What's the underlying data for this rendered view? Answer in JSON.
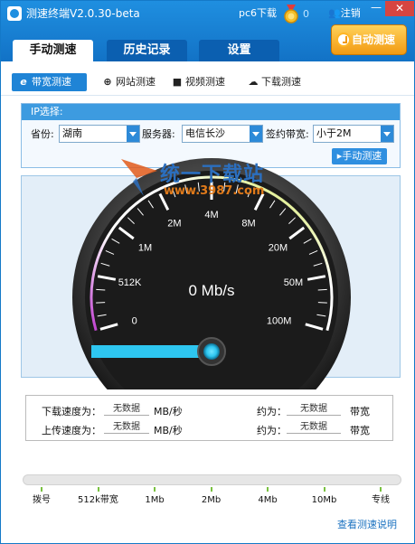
{
  "window": {
    "title": "测速终端V2.0.30-beta",
    "pc6_label": "pc6下载",
    "medal_count": "0",
    "logout_label": "注销",
    "minimize_glyph": "—",
    "close_glyph": "✕"
  },
  "main_tabs": [
    {
      "label": "手动测速",
      "active": true
    },
    {
      "label": "历史记录",
      "active": false
    },
    {
      "label": "设置",
      "active": false
    }
  ],
  "auto_test_label": "自动测速",
  "sub_tabs": [
    {
      "icon": "e",
      "label": "带宽测速",
      "active": true
    },
    {
      "icon": "globe-icon",
      "label": "网站测速"
    },
    {
      "icon": "video-camera-icon",
      "label": "视频测速"
    },
    {
      "icon": "cloud-download-icon",
      "label": "下载测速"
    }
  ],
  "ip_select": {
    "heading": "IP选择:",
    "province_label": "省份:",
    "province_value": "湖南",
    "server_label": "服务器:",
    "server_value": "电信长沙",
    "bandwidth_label": "签约带宽:",
    "bandwidth_value": "小于2M",
    "manual_test_label": "手动测速"
  },
  "watermark": {
    "text": "统一下载站",
    "url": "www.3987.com"
  },
  "gauge": {
    "speed_display": "0 Mb/s",
    "scale_labels": [
      "0",
      "512K",
      "1M",
      "2M",
      "4M",
      "8M",
      "20M",
      "50M",
      "100M"
    ],
    "current_fraction": 0,
    "colors": {
      "accent": "#2ec6f0",
      "rim_start": "#c03fd0",
      "rim_end": "#c9e23a",
      "face": "#1a1a1a"
    }
  },
  "results": {
    "download_label": "下载速度为：",
    "download_value": "无数据",
    "download_unit": "MB/秒",
    "download_approx_label": "约为：",
    "download_approx_value": "无数据",
    "download_approx_unit": "带宽",
    "upload_label": "上传速度为：",
    "upload_value": "无数据",
    "upload_unit": "MB/秒",
    "upload_approx_label": "约为：",
    "upload_approx_value": "无数据",
    "upload_approx_unit": "带宽"
  },
  "progress": {
    "value": 0,
    "labels": [
      "拨号",
      "512k带宽",
      "1Mb",
      "2Mb",
      "4Mb",
      "10Mb",
      "专线"
    ]
  },
  "help_link": "查看测速说明"
}
